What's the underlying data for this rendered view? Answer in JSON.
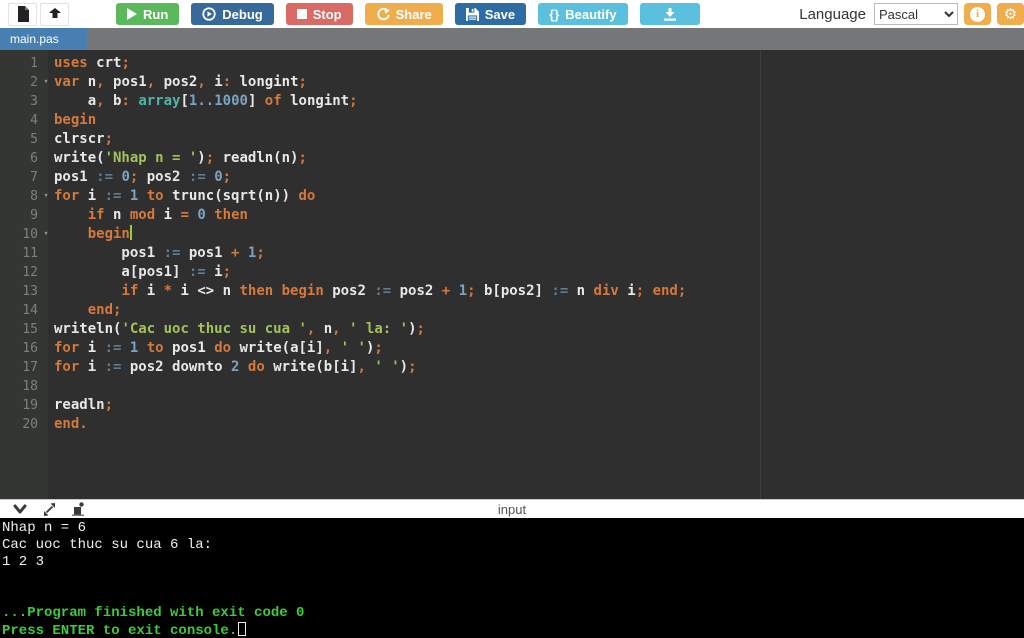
{
  "toolbar": {
    "run": "Run",
    "debug": "Debug",
    "stop": "Stop",
    "share": "Share",
    "save": "Save",
    "beautify_icon": "{}",
    "beautify": "Beautify",
    "language_label": "Language",
    "language_value": "Pascal",
    "info_glyph": "i",
    "gear_glyph": "⚙"
  },
  "tabs": {
    "active": "main.pas"
  },
  "console_bar": {
    "title": "input"
  },
  "editor": {
    "lines": [
      {
        "n": 1,
        "fold": false,
        "cursor": false,
        "tokens": [
          [
            "k",
            "uses"
          ],
          [
            "w",
            " crt"
          ],
          [
            "k",
            ";"
          ]
        ]
      },
      {
        "n": 2,
        "fold": true,
        "cursor": false,
        "tokens": [
          [
            "k",
            "var"
          ],
          [
            "w",
            " n"
          ],
          [
            "k",
            ","
          ],
          [
            "w",
            " pos1"
          ],
          [
            "k",
            ","
          ],
          [
            "w",
            " pos2"
          ],
          [
            "k",
            ","
          ],
          [
            "w",
            " i"
          ],
          [
            "k",
            ":"
          ],
          [
            "w",
            " longint"
          ],
          [
            "k",
            ";"
          ]
        ]
      },
      {
        "n": 3,
        "fold": false,
        "cursor": false,
        "tokens": [
          [
            "w",
            "    a"
          ],
          [
            "k",
            ","
          ],
          [
            "w",
            " b"
          ],
          [
            "k",
            ":"
          ],
          [
            "w",
            " "
          ],
          [
            "t",
            "array"
          ],
          [
            "w",
            "["
          ],
          [
            "n",
            "1..1000"
          ],
          [
            "w",
            "]"
          ],
          [
            "k",
            " of"
          ],
          [
            "w",
            " longint"
          ],
          [
            "k",
            ";"
          ]
        ]
      },
      {
        "n": 4,
        "fold": false,
        "cursor": false,
        "tokens": [
          [
            "k",
            "begin"
          ]
        ]
      },
      {
        "n": 5,
        "fold": false,
        "cursor": false,
        "tokens": [
          [
            "w",
            "clrscr"
          ],
          [
            "k",
            ";"
          ]
        ]
      },
      {
        "n": 6,
        "fold": false,
        "cursor": false,
        "tokens": [
          [
            "w",
            "write("
          ],
          [
            "s",
            "'Nhap n = '"
          ],
          [
            "w",
            ")"
          ],
          [
            "k",
            ";"
          ],
          [
            "w",
            " readln(n)"
          ],
          [
            "k",
            ";"
          ]
        ]
      },
      {
        "n": 7,
        "fold": false,
        "cursor": false,
        "tokens": [
          [
            "w",
            "pos1 "
          ],
          [
            "a",
            ":="
          ],
          [
            "w",
            " "
          ],
          [
            "n",
            "0"
          ],
          [
            "k",
            ";"
          ],
          [
            "w",
            " pos2 "
          ],
          [
            "a",
            ":="
          ],
          [
            "w",
            " "
          ],
          [
            "n",
            "0"
          ],
          [
            "k",
            ";"
          ]
        ]
      },
      {
        "n": 8,
        "fold": true,
        "cursor": false,
        "tokens": [
          [
            "k",
            "for"
          ],
          [
            "w",
            " i "
          ],
          [
            "a",
            ":="
          ],
          [
            "w",
            " "
          ],
          [
            "n",
            "1"
          ],
          [
            "k",
            " to"
          ],
          [
            "w",
            " trunc(sqrt(n)) "
          ],
          [
            "k",
            "do"
          ]
        ]
      },
      {
        "n": 9,
        "fold": false,
        "cursor": false,
        "tokens": [
          [
            "w",
            "    "
          ],
          [
            "k",
            "if"
          ],
          [
            "w",
            " n "
          ],
          [
            "k",
            "mod"
          ],
          [
            "w",
            " i "
          ],
          [
            "k",
            "="
          ],
          [
            "w",
            " "
          ],
          [
            "n",
            "0"
          ],
          [
            "k",
            " then"
          ]
        ]
      },
      {
        "n": 10,
        "fold": true,
        "cursor": true,
        "tokens": [
          [
            "w",
            "    "
          ],
          [
            "k",
            "begin"
          ]
        ]
      },
      {
        "n": 11,
        "fold": false,
        "cursor": false,
        "tokens": [
          [
            "w",
            "        pos1 "
          ],
          [
            "a",
            ":="
          ],
          [
            "w",
            " pos1 "
          ],
          [
            "k",
            "+"
          ],
          [
            "w",
            " "
          ],
          [
            "n",
            "1"
          ],
          [
            "k",
            ";"
          ]
        ]
      },
      {
        "n": 12,
        "fold": false,
        "cursor": false,
        "tokens": [
          [
            "w",
            "        a[pos1] "
          ],
          [
            "a",
            ":="
          ],
          [
            "w",
            " i"
          ],
          [
            "k",
            ";"
          ]
        ]
      },
      {
        "n": 13,
        "fold": false,
        "cursor": false,
        "tokens": [
          [
            "w",
            "        "
          ],
          [
            "k",
            "if"
          ],
          [
            "w",
            " i "
          ],
          [
            "k",
            "*"
          ],
          [
            "w",
            " i <> n "
          ],
          [
            "k",
            "then begin"
          ],
          [
            "w",
            " pos2 "
          ],
          [
            "a",
            ":="
          ],
          [
            "w",
            " pos2 "
          ],
          [
            "k",
            "+"
          ],
          [
            "w",
            " "
          ],
          [
            "n",
            "1"
          ],
          [
            "k",
            ";"
          ],
          [
            "w",
            " b[pos2] "
          ],
          [
            "a",
            ":="
          ],
          [
            "w",
            " n "
          ],
          [
            "k",
            "div"
          ],
          [
            "w",
            " i"
          ],
          [
            "k",
            ";"
          ],
          [
            "w",
            " "
          ],
          [
            "k",
            "end;"
          ]
        ]
      },
      {
        "n": 14,
        "fold": false,
        "cursor": false,
        "tokens": [
          [
            "w",
            "    "
          ],
          [
            "k",
            "end;"
          ]
        ]
      },
      {
        "n": 15,
        "fold": false,
        "cursor": false,
        "tokens": [
          [
            "w",
            "writeln("
          ],
          [
            "s",
            "'Cac uoc thuc su cua '"
          ],
          [
            "k",
            ","
          ],
          [
            "w",
            " n"
          ],
          [
            "k",
            ","
          ],
          [
            "w",
            " "
          ],
          [
            "s",
            "' la: '"
          ],
          [
            "w",
            ")"
          ],
          [
            "k",
            ";"
          ]
        ]
      },
      {
        "n": 16,
        "fold": false,
        "cursor": false,
        "tokens": [
          [
            "k",
            "for"
          ],
          [
            "w",
            " i "
          ],
          [
            "a",
            ":="
          ],
          [
            "w",
            " "
          ],
          [
            "n",
            "1"
          ],
          [
            "k",
            " to"
          ],
          [
            "w",
            " pos1 "
          ],
          [
            "k",
            "do"
          ],
          [
            "w",
            " write(a[i]"
          ],
          [
            "k",
            ","
          ],
          [
            "w",
            " "
          ],
          [
            "s",
            "' '"
          ],
          [
            "w",
            ")"
          ],
          [
            "k",
            ";"
          ]
        ]
      },
      {
        "n": 17,
        "fold": false,
        "cursor": false,
        "tokens": [
          [
            "k",
            "for"
          ],
          [
            "w",
            " i "
          ],
          [
            "a",
            ":="
          ],
          [
            "w",
            " pos2 downto "
          ],
          [
            "n",
            "2"
          ],
          [
            "k",
            " do"
          ],
          [
            "w",
            " write(b[i]"
          ],
          [
            "k",
            ","
          ],
          [
            "w",
            " "
          ],
          [
            "s",
            "' '"
          ],
          [
            "w",
            ")"
          ],
          [
            "k",
            ";"
          ]
        ]
      },
      {
        "n": 18,
        "fold": false,
        "cursor": false,
        "tokens": []
      },
      {
        "n": 19,
        "fold": false,
        "cursor": false,
        "tokens": [
          [
            "w",
            "readln"
          ],
          [
            "k",
            ";"
          ]
        ]
      },
      {
        "n": 20,
        "fold": false,
        "cursor": false,
        "tokens": [
          [
            "k",
            "end."
          ]
        ]
      }
    ]
  },
  "console": {
    "lines": [
      {
        "c": "w",
        "t": "Nhap n = 6",
        "cursor": false
      },
      {
        "c": "w",
        "t": "Cac uoc thuc su cua 6 la:",
        "cursor": false
      },
      {
        "c": "w",
        "t": "1 2 3",
        "cursor": false
      },
      {
        "c": "w",
        "t": "",
        "cursor": false
      },
      {
        "c": "w",
        "t": "",
        "cursor": false
      },
      {
        "c": "g",
        "t": "...Program finished with exit code 0",
        "cursor": false
      },
      {
        "c": "g",
        "t": "Press ENTER to exit console.",
        "cursor": true
      }
    ]
  },
  "colors": {
    "run_green": "#5cb85c",
    "debug_blue": "#38699b",
    "stop_red": "#d96a66",
    "share_orange": "#f0ad4e",
    "save_blue": "#2e6da4",
    "beautify_cyan": "#5bc0de",
    "accent_orange": "#f0ad4e",
    "tab_blue": "#477fb2",
    "tabbar_gray": "#757779",
    "editor_bg": "#2e2f2e",
    "gutter_bg": "#343634",
    "kw": "#d5793c",
    "plain": "#e8e8e6",
    "num": "#7ba3c4",
    "str": "#a2c25c",
    "assign": "#5f7c95",
    "builtin": "#4fb4ab",
    "linenum": "#7e8079",
    "cursor_green": "#9acd32",
    "console_green": "#3bcb3b",
    "console_white": "#f0f0f0"
  }
}
